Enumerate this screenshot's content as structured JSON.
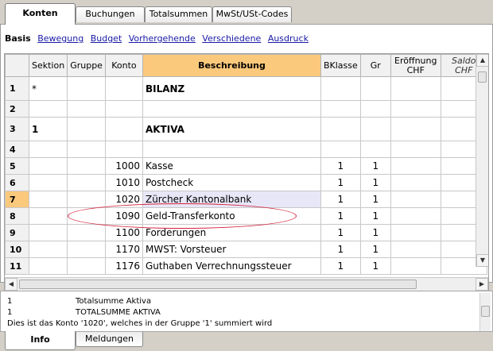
{
  "tabs": [
    "Konten",
    "Buchungen",
    "Totalsummen",
    "MwSt/USt-Codes"
  ],
  "subnav": [
    "Basis",
    "Bewegung",
    "Budget",
    "Vorhergehende",
    "Verschiedene",
    "Ausdruck"
  ],
  "columns": {
    "sektion": "Sektion",
    "gruppe": "Gruppe",
    "konto": "Konto",
    "beschreibung": "Beschreibung",
    "bklasse": "BKlasse",
    "gr": "Gr",
    "eroeffnung_1": "Eröffnung",
    "eroeffnung_2": "CHF",
    "saldo_1": "Saldo",
    "saldo_2": "CHF"
  },
  "rows": [
    {
      "rn": "1",
      "sektion": "*",
      "gruppe": "",
      "konto": "",
      "desc": "BILANZ",
      "bk": "",
      "gr": ""
    },
    {
      "rn": "2",
      "sektion": "",
      "gruppe": "",
      "konto": "",
      "desc": "",
      "bk": "",
      "gr": ""
    },
    {
      "rn": "3",
      "sektion": "1",
      "gruppe": "",
      "konto": "",
      "desc": "AKTIVA",
      "bk": "",
      "gr": ""
    },
    {
      "rn": "4",
      "sektion": "",
      "gruppe": "",
      "konto": "",
      "desc": "",
      "bk": "",
      "gr": ""
    },
    {
      "rn": "5",
      "sektion": "",
      "gruppe": "",
      "konto": "1000",
      "desc": "Kasse",
      "bk": "1",
      "gr": "1"
    },
    {
      "rn": "6",
      "sektion": "",
      "gruppe": "",
      "konto": "1010",
      "desc": "Postcheck",
      "bk": "1",
      "gr": "1"
    },
    {
      "rn": "7",
      "sektion": "",
      "gruppe": "",
      "konto": "1020",
      "desc": "Zürcher Kantonalbank",
      "bk": "1",
      "gr": "1"
    },
    {
      "rn": "8",
      "sektion": "",
      "gruppe": "",
      "konto": "1090",
      "desc": "Geld-Transferkonto",
      "bk": "1",
      "gr": "1"
    },
    {
      "rn": "9",
      "sektion": "",
      "gruppe": "",
      "konto": "1100",
      "desc": "Forderungen",
      "bk": "1",
      "gr": "1"
    },
    {
      "rn": "10",
      "sektion": "",
      "gruppe": "",
      "konto": "1170",
      "desc": "MWST: Vorsteuer",
      "bk": "1",
      "gr": "1"
    },
    {
      "rn": "11",
      "sektion": "",
      "gruppe": "",
      "konto": "1176",
      "desc": "Guthaben Verrechnungssteuer",
      "bk": "1",
      "gr": "1"
    }
  ],
  "info": [
    {
      "a": "1",
      "b": "Totalsumme Aktiva"
    },
    {
      "a": "1",
      "b": "TOTALSUMME AKTIVA"
    },
    {
      "a": "Dies ist das Konto '1020', welches in der Gruppe '1' summiert wird",
      "b": ""
    }
  ],
  "bottom_tabs": [
    "Info",
    "Meldungen"
  ]
}
